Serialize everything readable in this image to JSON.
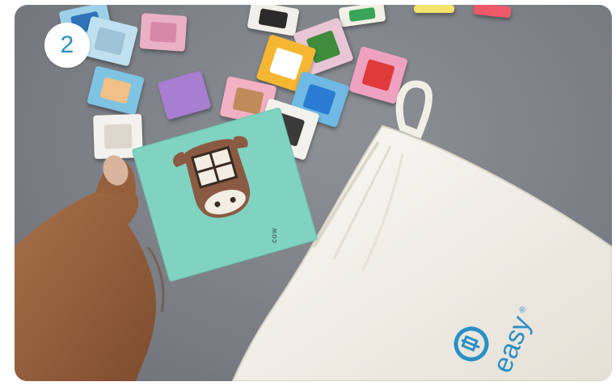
{
  "step_badge": {
    "number": "2"
  },
  "card": {
    "word": "cow"
  },
  "bag": {
    "brand": "easy",
    "registered_mark": "®"
  },
  "colors": {
    "table": "#7c8086",
    "card": "#7fd3c0",
    "bag": "#f3f0e8",
    "brand_blue": "#2b8fc5",
    "badge_text": "#2b8fc5"
  },
  "icons": [
    "cow-face-icon",
    "brand-logo-icon"
  ]
}
